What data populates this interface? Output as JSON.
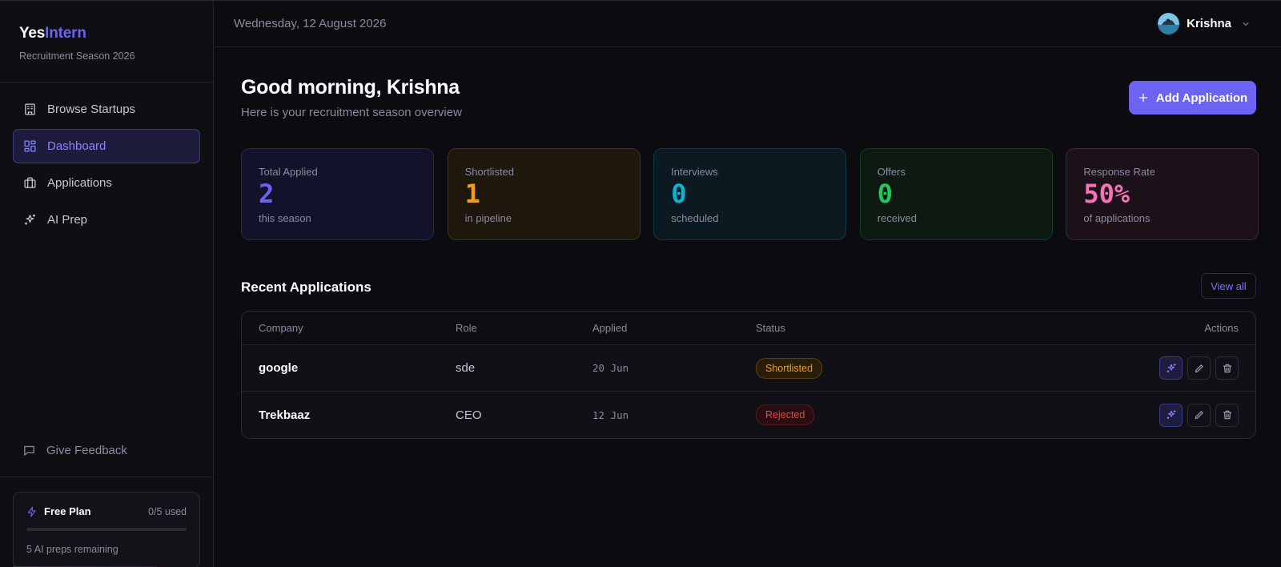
{
  "brand": {
    "name_part1": "Yes",
    "name_part2": "Intern",
    "subtitle": "Recruitment Season 2026"
  },
  "sidebar": {
    "items": [
      {
        "label": "Browse Startups",
        "icon": "building-icon",
        "active": false
      },
      {
        "label": "Dashboard",
        "icon": "grid-icon",
        "active": true
      },
      {
        "label": "Applications",
        "icon": "briefcase-icon",
        "active": false
      },
      {
        "label": "AI Prep",
        "icon": "sparkles-icon",
        "active": false
      }
    ],
    "feedback_label": "Give Feedback",
    "plan": {
      "title": "Free Plan",
      "used": "0/5 used",
      "used_fraction": 0,
      "remaining": "5 AI preps remaining"
    }
  },
  "topbar": {
    "date": "Wednesday, 12 August 2026",
    "user_name": "Krishna"
  },
  "main": {
    "greeting": "Good morning, Krishna",
    "subtitle": "Here is your recruitment season overview",
    "add_button": "Add Application",
    "stats": [
      {
        "label": "Total Applied",
        "value": "2",
        "sub": "this season",
        "color": "#6c63f5",
        "bg": "#12122a",
        "border": "#2a2955"
      },
      {
        "label": "Shortlisted",
        "value": "1",
        "sub": "in pipeline",
        "color": "#f59e0b",
        "bg": "#1e170b",
        "border": "#4a3710"
      },
      {
        "label": "Interviews",
        "value": "0",
        "sub": "scheduled",
        "color": "#06b6d4",
        "bg": "#0b1a20",
        "border": "#0f3a45"
      },
      {
        "label": "Offers",
        "value": "0",
        "sub": "received",
        "color": "#22c55e",
        "bg": "#0c1a12",
        "border": "#153d23"
      },
      {
        "label": "Response Rate",
        "value": "50%",
        "sub": "of applications",
        "color": "#f472b6",
        "bg": "#1d1119",
        "border": "#4a2139"
      }
    ],
    "recent_title": "Recent Applications",
    "view_all": "View all",
    "table": {
      "headers": {
        "company": "Company",
        "role": "Role",
        "applied": "Applied",
        "status": "Status",
        "actions": "Actions"
      },
      "rows": [
        {
          "company": "google",
          "role": "sde",
          "applied": "20 Jun",
          "status": "Shortlisted",
          "status_color": "#f59e0b",
          "status_bg": "#2a1d08",
          "status_border": "#5a3f0f"
        },
        {
          "company": "Trekbaaz",
          "role": "CEO",
          "applied": "12 Jun",
          "status": "Rejected",
          "status_color": "#ef4444",
          "status_bg": "#2a0d10",
          "status_border": "#5a1a1f"
        }
      ]
    }
  }
}
